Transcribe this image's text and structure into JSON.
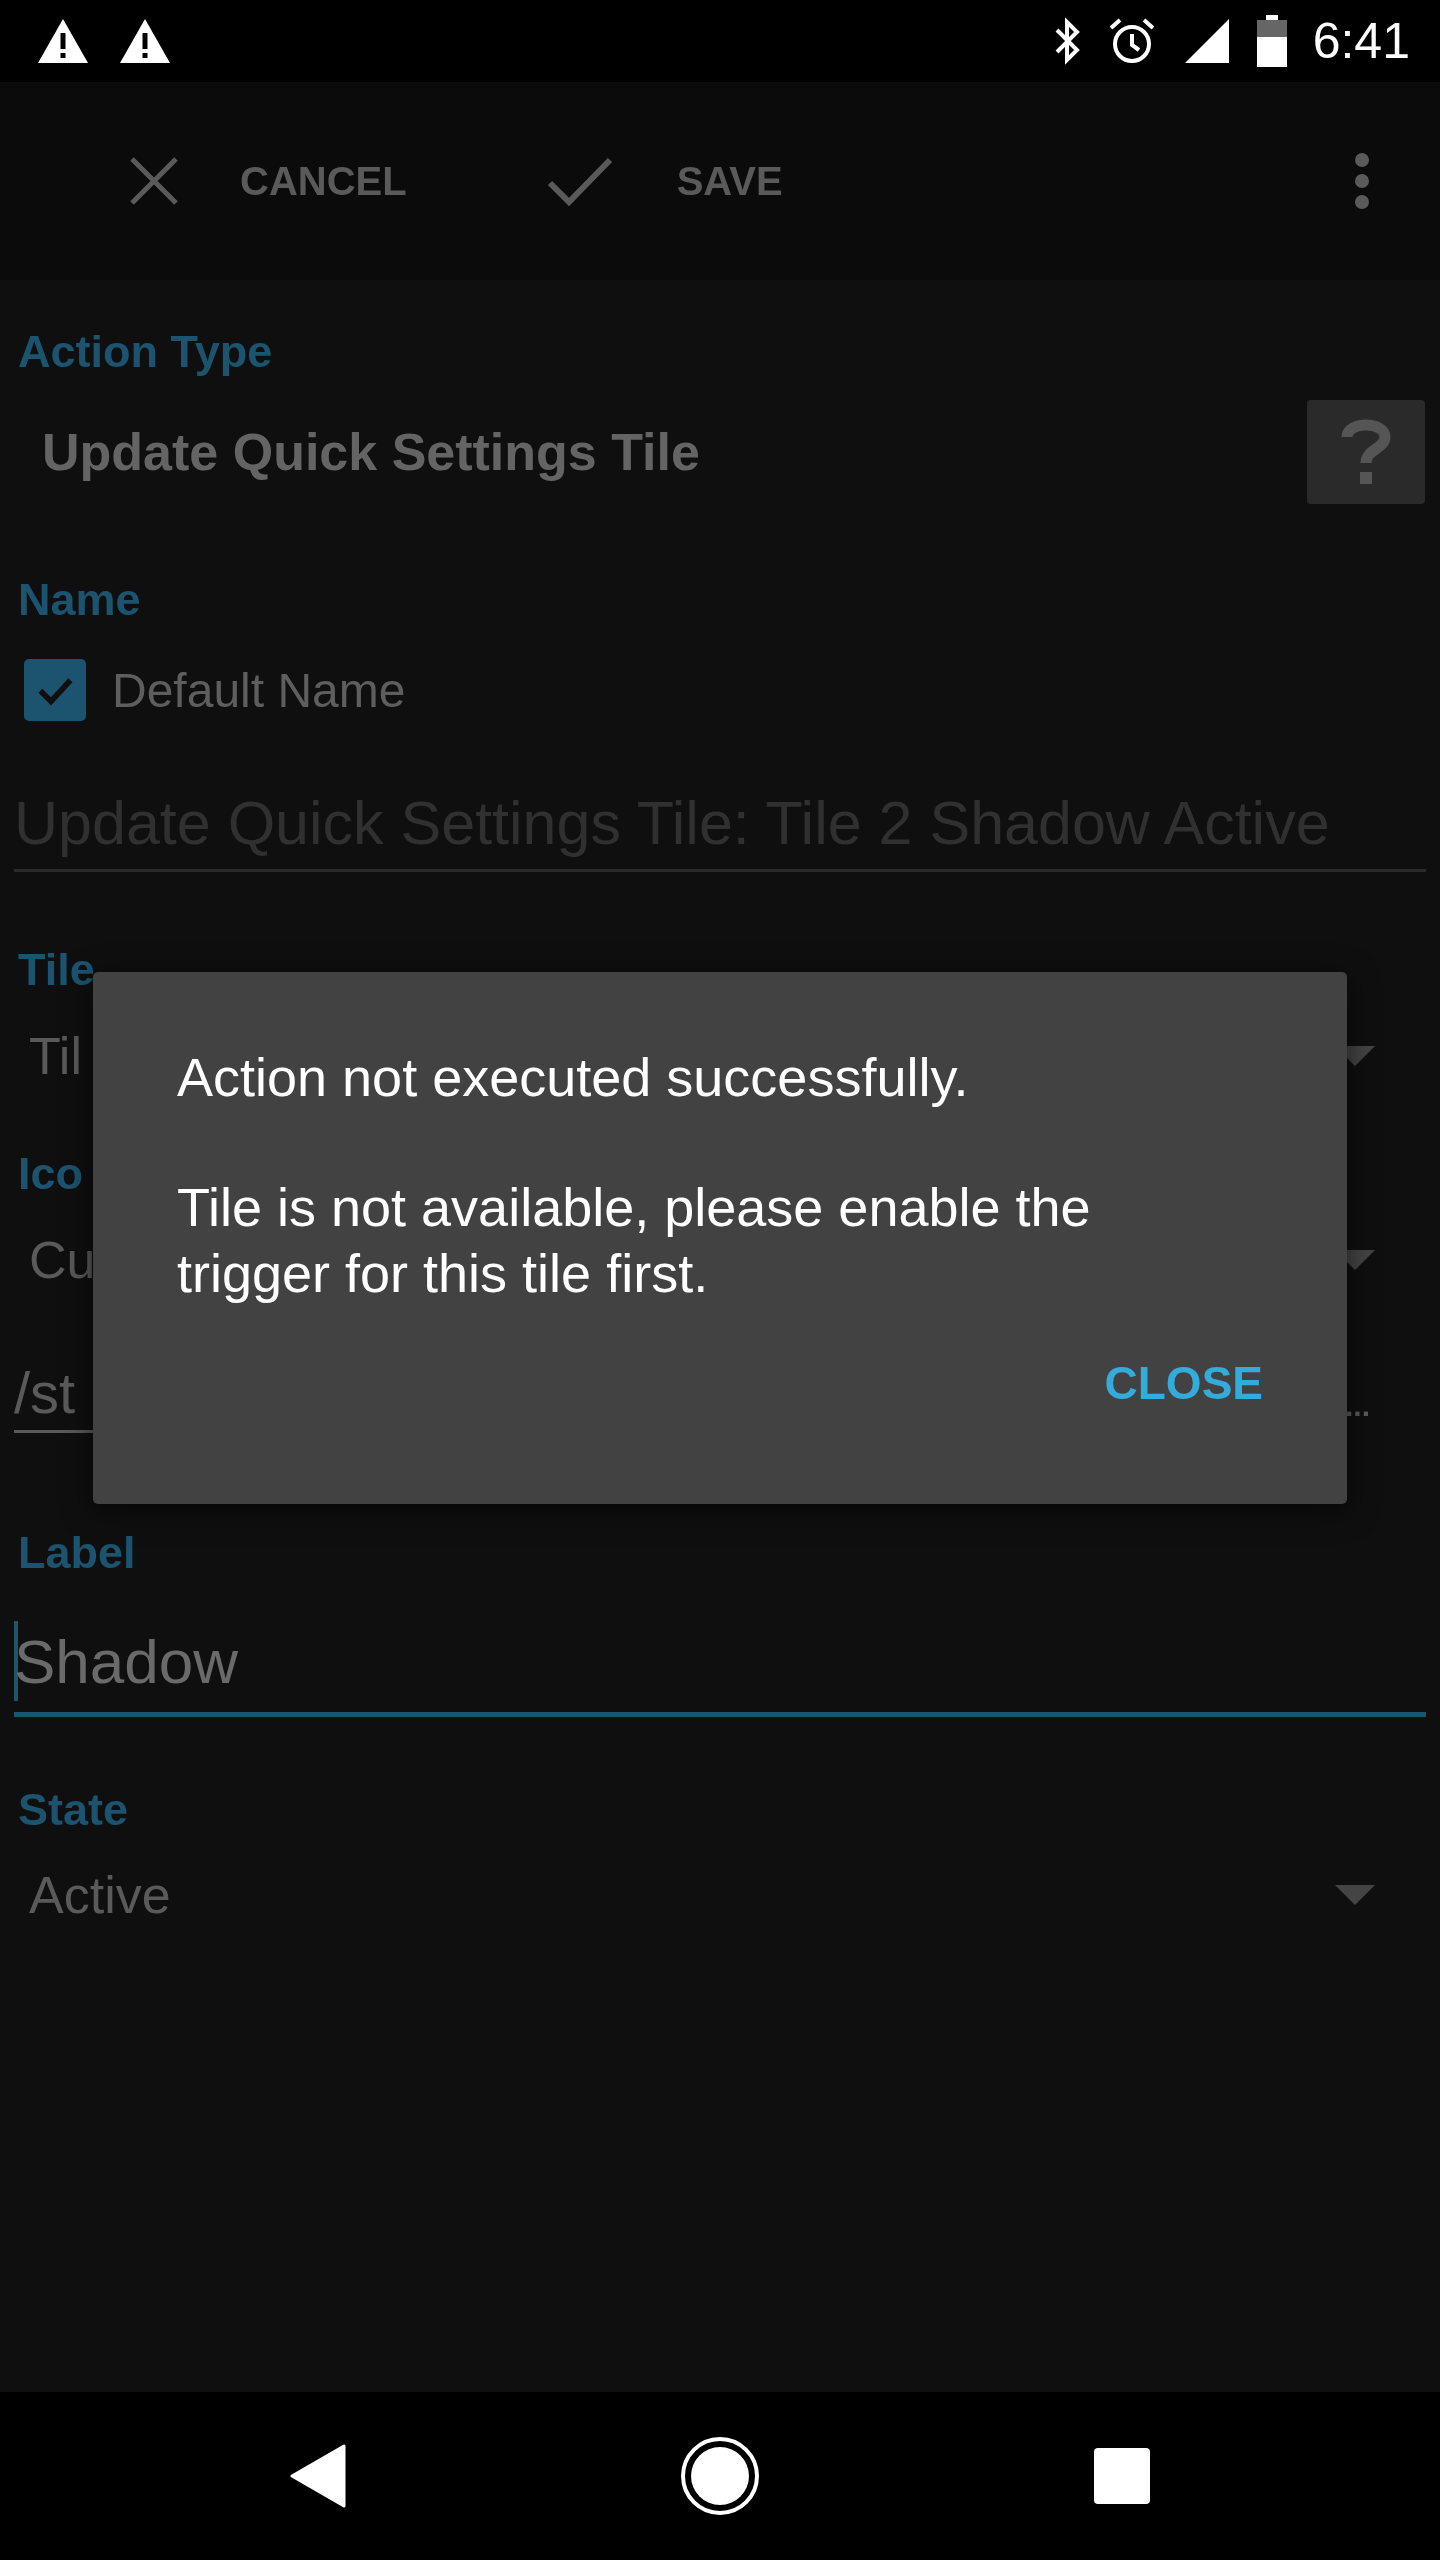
{
  "status_bar": {
    "time": "6:41"
  },
  "toolbar": {
    "buttons": [
      {
        "label": "CANCEL",
        "kind": "cancel"
      },
      {
        "label": "SAVE",
        "kind": "save"
      }
    ]
  },
  "action_type": {
    "label": "Action Type",
    "value": "Update Quick Settings Tile"
  },
  "name": {
    "label": "Name",
    "default_checkbox": {
      "label": "Default Name",
      "checked": true
    },
    "value": "Update Quick Settings Tile: Tile 2 Shadow Active",
    "disabled": true
  },
  "tile": {
    "label": "Tile",
    "value": "Til"
  },
  "icon": {
    "label": "Ico",
    "value": "Cu",
    "path": "/st",
    "browse": "..."
  },
  "label": {
    "label": "Label",
    "value": "Shadow",
    "focused": true
  },
  "state": {
    "label": "State",
    "value": "Active"
  },
  "dialog": {
    "message": "Action not executed successfully.",
    "detail": "Tile is not available, please enable the trigger for this tile first.",
    "button": "CLOSE"
  }
}
